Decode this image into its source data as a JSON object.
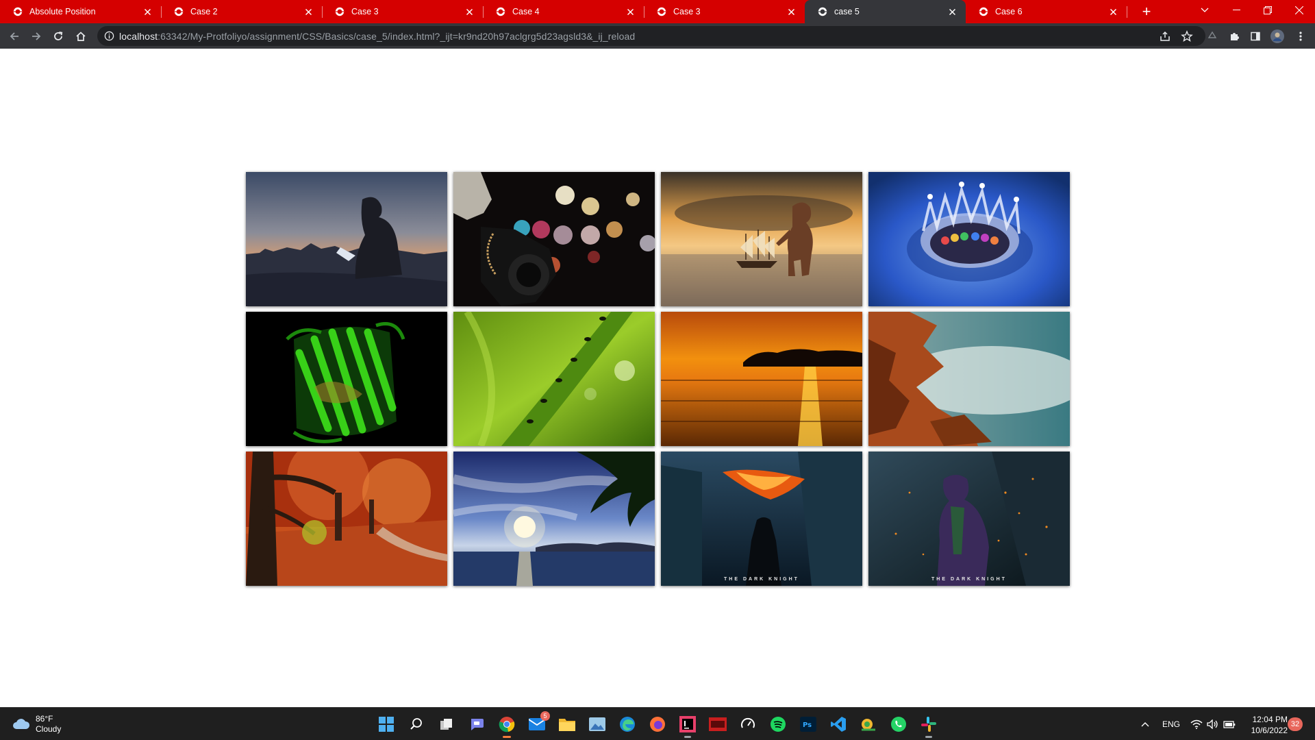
{
  "browser": {
    "tabs": [
      {
        "title": "Absolute Position",
        "active": false
      },
      {
        "title": "Case 2",
        "active": false
      },
      {
        "title": "Case 3",
        "active": false
      },
      {
        "title": "Case 4",
        "active": false
      },
      {
        "title": "Case 3",
        "active": false
      },
      {
        "title": "case 5",
        "active": true
      },
      {
        "title": "Case 6",
        "active": false
      }
    ],
    "new_tab_icon": "plus-icon",
    "address_host": "localhost",
    "address_rest": ":63342/My-Protfoliyo/assignment/CSS/Basics/case_5/index.html?_ijt=kr9nd20h97aclgrg5d23agsld3&_ij_reload",
    "accent_color": "#d50000"
  },
  "gallery": {
    "photos": [
      {
        "subject": "man with laptop overlooking city at dusk"
      },
      {
        "subject": "hand holding camera with bokeh lights"
      },
      {
        "subject": "child with toy ship at sunset"
      },
      {
        "subject": "water droplet splash crown"
      },
      {
        "subject": "green fluorescent protein ribbon structure"
      },
      {
        "subject": "ants walking on grass blade"
      },
      {
        "subject": "orange sunset over lake with island"
      },
      {
        "subject": "misty coast with orange rocks"
      },
      {
        "subject": "autumn tree-lined path"
      },
      {
        "subject": "sun over sea with palm tree"
      },
      {
        "subject": "dark knight batman poster",
        "caption": "THE DARK KNIGHT"
      },
      {
        "subject": "dark knight joker poster",
        "caption": "THE DARK KNIGHT"
      }
    ]
  },
  "taskbar": {
    "weather_temp": "86°F",
    "weather_condition": "Cloudy",
    "mail_badge": "5",
    "language": "ENG",
    "time": "12:04 PM",
    "date": "10/6/2022",
    "notification_count": "32"
  }
}
